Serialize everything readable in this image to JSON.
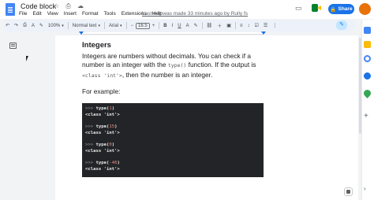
{
  "app": {
    "doc_title": "Code block",
    "title_icons": "☆ ⎙ ☁",
    "menus": [
      "File",
      "Edit",
      "View",
      "Insert",
      "Format",
      "Tools",
      "Extensions",
      "Help"
    ],
    "last_edit": "Last edit was made 33 minutes ago by Rully fs",
    "share_label": "Share"
  },
  "toolbar": {
    "undo": "↶",
    "redo": "↷",
    "print": "⎙",
    "spellcheck": "A",
    "paint_format": "✎",
    "zoom": "100%",
    "style": "Normal text",
    "font": "Arial",
    "minus": "−",
    "font_size": "16.5",
    "plus": "+",
    "bold": "B",
    "italic": "I",
    "underline": "U",
    "text_color": "A",
    "highlight": "✎",
    "link": "🔗",
    "comment": "＋",
    "image": "▣",
    "align": "≡",
    "line_spacing": "↕",
    "checklist": "☑",
    "bullets": "☰",
    "numbered": "⒈",
    "indent_less": "⇤",
    "indent_more": "⇥",
    "clear": "T̸",
    "more": "⋮",
    "edit_mode": "✎"
  },
  "document": {
    "heading": "Integers",
    "para_part1": "Integers are numbers without decimals. You can check if a number is an integer with the ",
    "para_code1": "type()",
    "para_part2": " function. If the output is ",
    "para_code2": "<class 'int'>",
    "para_part3": ", then the number is an integer.",
    "for_example": "For example:",
    "code_lines": [
      {
        "prompt": ">>> ",
        "fn": "type(",
        "num": "1",
        "close": ")"
      },
      {
        "out": "<class ",
        "str": "'int'",
        "end": ">"
      },
      {
        "prompt": ">>> ",
        "fn": "type(",
        "num": "15",
        "close": ")"
      },
      {
        "out": "<class ",
        "str": "'int'",
        "end": ">"
      },
      {
        "prompt": ">>> ",
        "fn": "type(",
        "num": "0",
        "close": ")"
      },
      {
        "out": "<class ",
        "str": "'int'",
        "end": ">"
      },
      {
        "prompt": ">>> ",
        "fn": "type(",
        "num": "-46",
        "close": ")"
      },
      {
        "out": "<class ",
        "str": "'int'",
        "end": ">"
      }
    ]
  },
  "colors": {
    "share": "#1a73e8",
    "code_bg": "#222427",
    "number": "#f28b82",
    "toolbar_bg": "#edf2fa"
  },
  "side_panel_icons": [
    "calendar-icon",
    "keep-icon",
    "tasks-icon",
    "contacts-icon",
    "maps-icon"
  ]
}
